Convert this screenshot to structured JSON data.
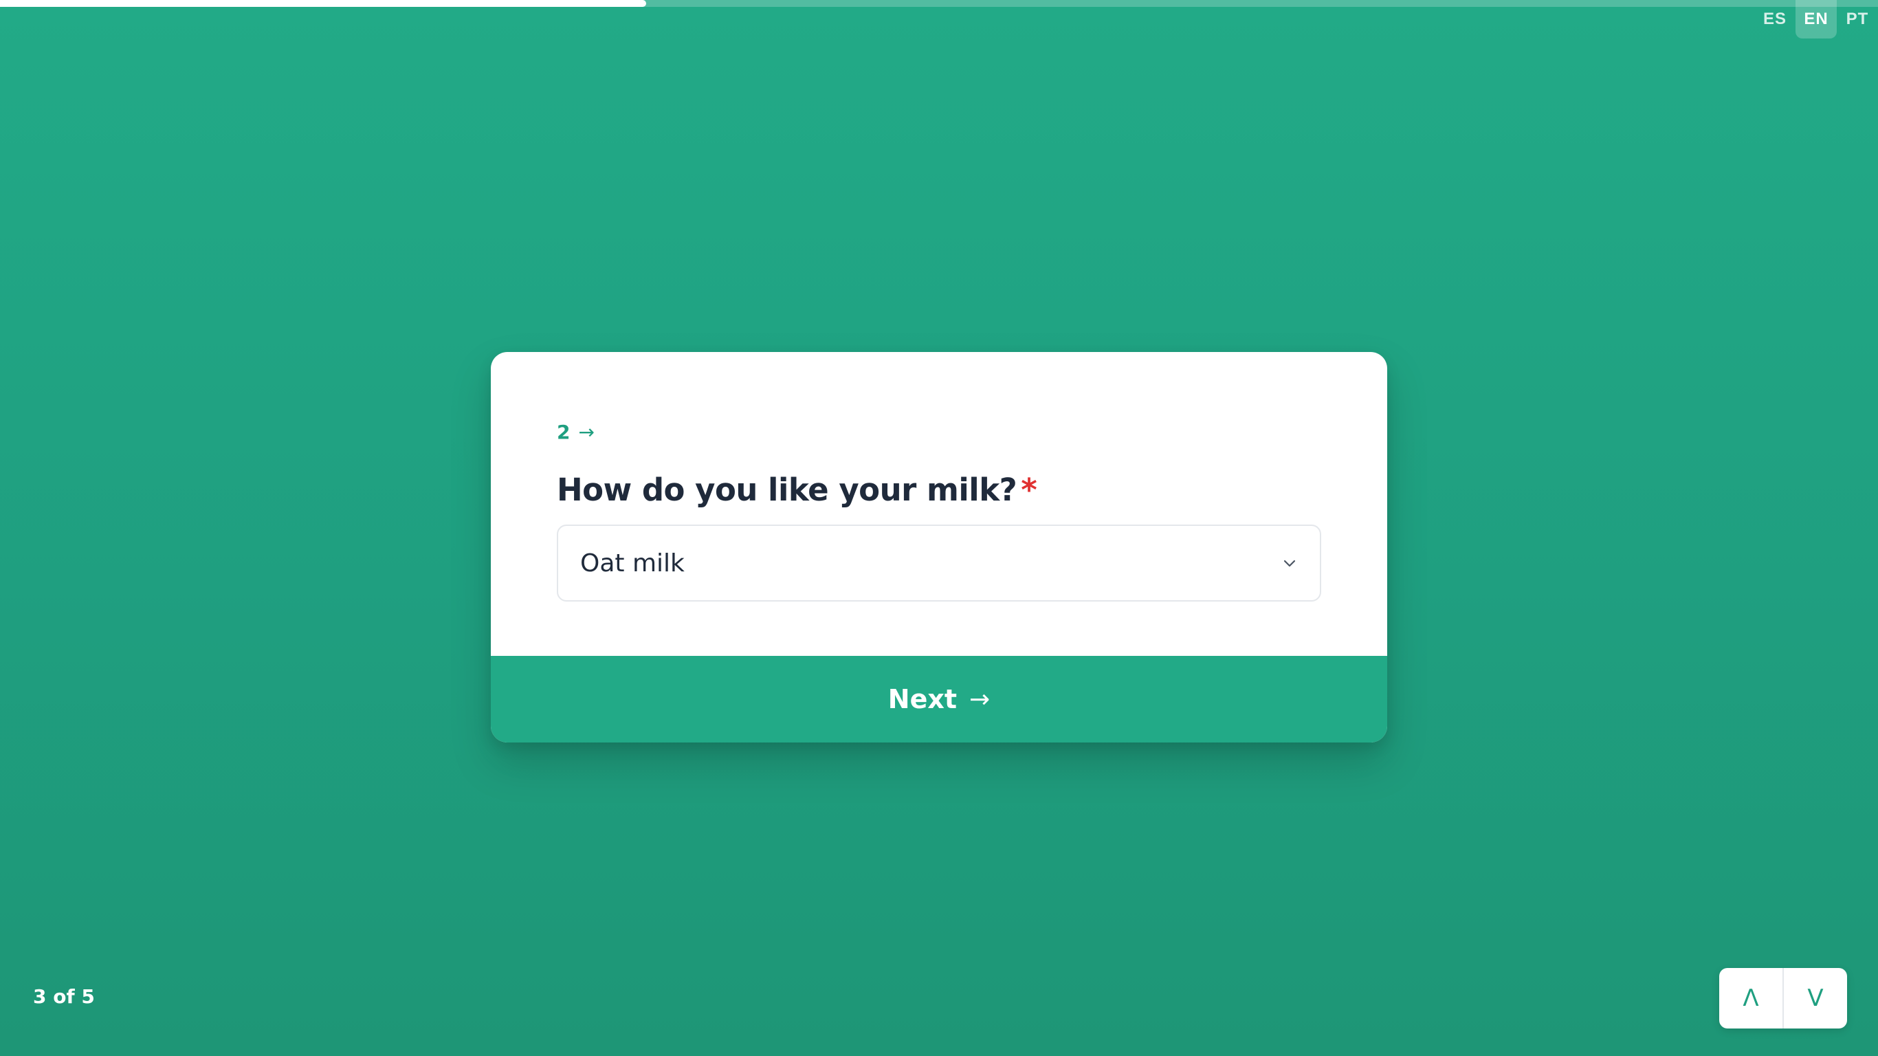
{
  "progress": {
    "fraction": 0.344
  },
  "languages": [
    {
      "code": "ES",
      "active": false
    },
    {
      "code": "EN",
      "active": true
    },
    {
      "code": "PT",
      "active": false
    }
  ],
  "question": {
    "number": "2",
    "number_arrow": "→",
    "title": "How do you like your milk?",
    "required_marker": "*",
    "selected_value": "Oat milk"
  },
  "next_button": {
    "label": "Next",
    "arrow": "→"
  },
  "step_counter": "3 of 5",
  "navigation": {
    "up_label": "Λ",
    "down_label": "V"
  },
  "colors": {
    "accent": "#22aa87",
    "required": "#e03131",
    "text": "#1f2a3b"
  }
}
